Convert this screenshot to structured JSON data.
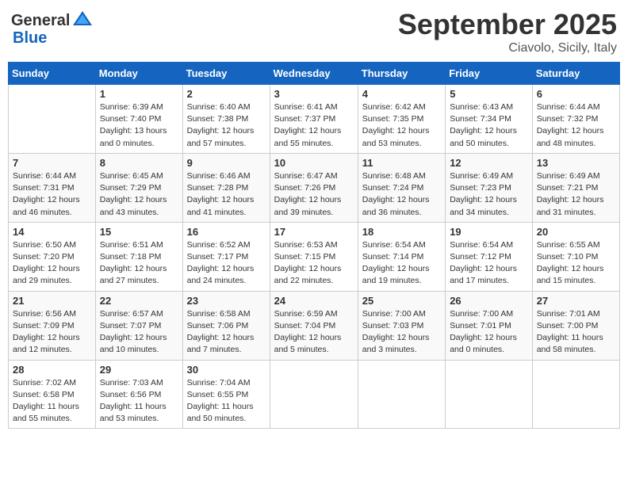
{
  "header": {
    "logo_general": "General",
    "logo_blue": "Blue",
    "month": "September 2025",
    "location": "Ciavolo, Sicily, Italy"
  },
  "days_of_week": [
    "Sunday",
    "Monday",
    "Tuesday",
    "Wednesday",
    "Thursday",
    "Friday",
    "Saturday"
  ],
  "weeks": [
    [
      {
        "day": "",
        "info": ""
      },
      {
        "day": "1",
        "info": "Sunrise: 6:39 AM\nSunset: 7:40 PM\nDaylight: 13 hours\nand 0 minutes."
      },
      {
        "day": "2",
        "info": "Sunrise: 6:40 AM\nSunset: 7:38 PM\nDaylight: 12 hours\nand 57 minutes."
      },
      {
        "day": "3",
        "info": "Sunrise: 6:41 AM\nSunset: 7:37 PM\nDaylight: 12 hours\nand 55 minutes."
      },
      {
        "day": "4",
        "info": "Sunrise: 6:42 AM\nSunset: 7:35 PM\nDaylight: 12 hours\nand 53 minutes."
      },
      {
        "day": "5",
        "info": "Sunrise: 6:43 AM\nSunset: 7:34 PM\nDaylight: 12 hours\nand 50 minutes."
      },
      {
        "day": "6",
        "info": "Sunrise: 6:44 AM\nSunset: 7:32 PM\nDaylight: 12 hours\nand 48 minutes."
      }
    ],
    [
      {
        "day": "7",
        "info": "Sunrise: 6:44 AM\nSunset: 7:31 PM\nDaylight: 12 hours\nand 46 minutes."
      },
      {
        "day": "8",
        "info": "Sunrise: 6:45 AM\nSunset: 7:29 PM\nDaylight: 12 hours\nand 43 minutes."
      },
      {
        "day": "9",
        "info": "Sunrise: 6:46 AM\nSunset: 7:28 PM\nDaylight: 12 hours\nand 41 minutes."
      },
      {
        "day": "10",
        "info": "Sunrise: 6:47 AM\nSunset: 7:26 PM\nDaylight: 12 hours\nand 39 minutes."
      },
      {
        "day": "11",
        "info": "Sunrise: 6:48 AM\nSunset: 7:24 PM\nDaylight: 12 hours\nand 36 minutes."
      },
      {
        "day": "12",
        "info": "Sunrise: 6:49 AM\nSunset: 7:23 PM\nDaylight: 12 hours\nand 34 minutes."
      },
      {
        "day": "13",
        "info": "Sunrise: 6:49 AM\nSunset: 7:21 PM\nDaylight: 12 hours\nand 31 minutes."
      }
    ],
    [
      {
        "day": "14",
        "info": "Sunrise: 6:50 AM\nSunset: 7:20 PM\nDaylight: 12 hours\nand 29 minutes."
      },
      {
        "day": "15",
        "info": "Sunrise: 6:51 AM\nSunset: 7:18 PM\nDaylight: 12 hours\nand 27 minutes."
      },
      {
        "day": "16",
        "info": "Sunrise: 6:52 AM\nSunset: 7:17 PM\nDaylight: 12 hours\nand 24 minutes."
      },
      {
        "day": "17",
        "info": "Sunrise: 6:53 AM\nSunset: 7:15 PM\nDaylight: 12 hours\nand 22 minutes."
      },
      {
        "day": "18",
        "info": "Sunrise: 6:54 AM\nSunset: 7:14 PM\nDaylight: 12 hours\nand 19 minutes."
      },
      {
        "day": "19",
        "info": "Sunrise: 6:54 AM\nSunset: 7:12 PM\nDaylight: 12 hours\nand 17 minutes."
      },
      {
        "day": "20",
        "info": "Sunrise: 6:55 AM\nSunset: 7:10 PM\nDaylight: 12 hours\nand 15 minutes."
      }
    ],
    [
      {
        "day": "21",
        "info": "Sunrise: 6:56 AM\nSunset: 7:09 PM\nDaylight: 12 hours\nand 12 minutes."
      },
      {
        "day": "22",
        "info": "Sunrise: 6:57 AM\nSunset: 7:07 PM\nDaylight: 12 hours\nand 10 minutes."
      },
      {
        "day": "23",
        "info": "Sunrise: 6:58 AM\nSunset: 7:06 PM\nDaylight: 12 hours\nand 7 minutes."
      },
      {
        "day": "24",
        "info": "Sunrise: 6:59 AM\nSunset: 7:04 PM\nDaylight: 12 hours\nand 5 minutes."
      },
      {
        "day": "25",
        "info": "Sunrise: 7:00 AM\nSunset: 7:03 PM\nDaylight: 12 hours\nand 3 minutes."
      },
      {
        "day": "26",
        "info": "Sunrise: 7:00 AM\nSunset: 7:01 PM\nDaylight: 12 hours\nand 0 minutes."
      },
      {
        "day": "27",
        "info": "Sunrise: 7:01 AM\nSunset: 7:00 PM\nDaylight: 11 hours\nand 58 minutes."
      }
    ],
    [
      {
        "day": "28",
        "info": "Sunrise: 7:02 AM\nSunset: 6:58 PM\nDaylight: 11 hours\nand 55 minutes."
      },
      {
        "day": "29",
        "info": "Sunrise: 7:03 AM\nSunset: 6:56 PM\nDaylight: 11 hours\nand 53 minutes."
      },
      {
        "day": "30",
        "info": "Sunrise: 7:04 AM\nSunset: 6:55 PM\nDaylight: 11 hours\nand 50 minutes."
      },
      {
        "day": "",
        "info": ""
      },
      {
        "day": "",
        "info": ""
      },
      {
        "day": "",
        "info": ""
      },
      {
        "day": "",
        "info": ""
      }
    ]
  ]
}
